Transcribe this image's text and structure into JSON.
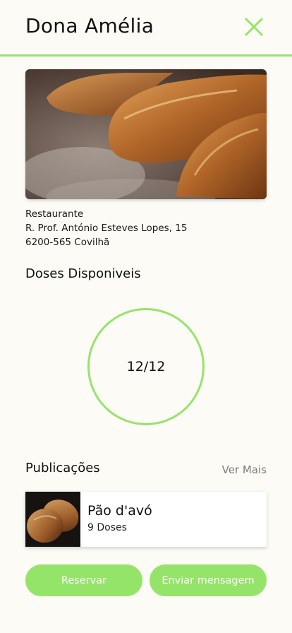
{
  "header": {
    "title": "Dona Amélia",
    "close_icon": "close-icon"
  },
  "info": {
    "category": "Restaurante",
    "address_line1": "R. Prof. António Esteves Lopes, 15",
    "address_line2": "6200-565 Covilhã"
  },
  "doses": {
    "title": "Doses Disponiveis",
    "count": "12/12",
    "available": 12,
    "total": 12
  },
  "publications": {
    "title": "Publicações",
    "see_more": "Ver Mais",
    "items": [
      {
        "name": "Pão d'avó",
        "doses": "9 Doses"
      }
    ]
  },
  "actions": {
    "reserve": "Reservar",
    "message": "Enviar mensagem"
  },
  "colors": {
    "accent": "#95e46a",
    "background": "#fcfbf5"
  }
}
